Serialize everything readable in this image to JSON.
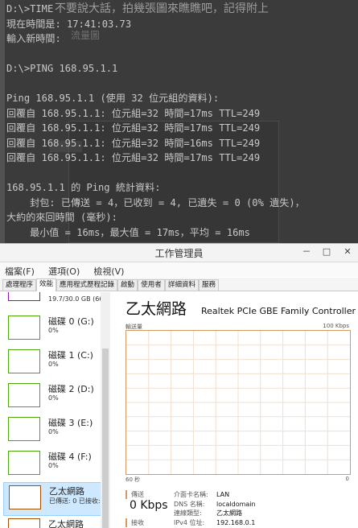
{
  "console": {
    "banner": "不要說大話，拍幾張圖來瞧瞧吧，記得附上",
    "banner2": "流量圖",
    "lines": [
      "D:\\>TIME",
      "現在時間是: 17:41:03.73",
      "輸入新時間:",
      "",
      "D:\\>PING 168.95.1.1",
      "",
      "Ping 168.95.1.1 (使用 32 位元組的資料):",
      "回覆自 168.95.1.1: 位元組=32 時間=17ms TTL=249",
      "回覆自 168.95.1.1: 位元組=32 時間=17ms TTL=249",
      "回覆自 168.95.1.1: 位元組=32 時間=16ms TTL=249",
      "回覆自 168.95.1.1: 位元組=32 時間=17ms TTL=249",
      "",
      "168.95.1.1 的 Ping 統計資料:",
      "    封包: 已傳送 = 4，已收到 = 4, 已遺失 = 0 (0% 遺失)，",
      "大約的來回時間 (毫秒):",
      "    最小值 = 16ms，最大值 = 17ms，平均 = 16ms"
    ]
  },
  "taskmanager": {
    "title": "工作管理員",
    "window_buttons": [
      "－",
      "□",
      "✕"
    ],
    "menu": [
      "檔案(F)",
      "選項(O)",
      "檢視(V)"
    ],
    "tabs": [
      "處理程序",
      "效能",
      "應用程式歷程記錄",
      "啟動",
      "使用者",
      "詳細資料",
      "服務"
    ],
    "active_tab": "效能",
    "sidebar": {
      "partial_top": "19.7/30.0 GB (66",
      "items": [
        {
          "name": "磁碟 0 (G:)",
          "value": "0%",
          "color": "#4da60c"
        },
        {
          "name": "磁碟 1 (C:)",
          "value": "0%",
          "color": "#4da60c"
        },
        {
          "name": "磁碟 2 (D:)",
          "value": "0%",
          "color": "#4da60c"
        },
        {
          "name": "磁碟 3 (E:)",
          "value": "0%",
          "color": "#4da60c"
        },
        {
          "name": "磁碟 4 (F:)",
          "value": "0%",
          "color": "#4da60c"
        },
        {
          "name": "乙太網路",
          "value": "已傳送: 0 已接收:",
          "color": "#a74f01"
        },
        {
          "name": "乙太網路",
          "value": "",
          "color": "#a74f01"
        }
      ]
    },
    "detail": {
      "title": "乙太網路",
      "adapter": "Realtek PCIe GBE Family Controller",
      "axis_label": "輸送量",
      "axis_max": "100 Kbps",
      "axis_time": "60 秒",
      "axis_zero": "0",
      "send_label": "傳送",
      "send_value": "0 Kbps",
      "recv_label": "接收",
      "info_labels": [
        "介面卡名稱:",
        "DNS 名稱:",
        "連線類型:",
        "IPv4 位址:"
      ],
      "info_values": [
        "LAN",
        "localdomain",
        "乙太網路",
        "192.168.0.1"
      ],
      "accent": "#d49a62",
      "grid_color": "#f0dfcf"
    }
  }
}
